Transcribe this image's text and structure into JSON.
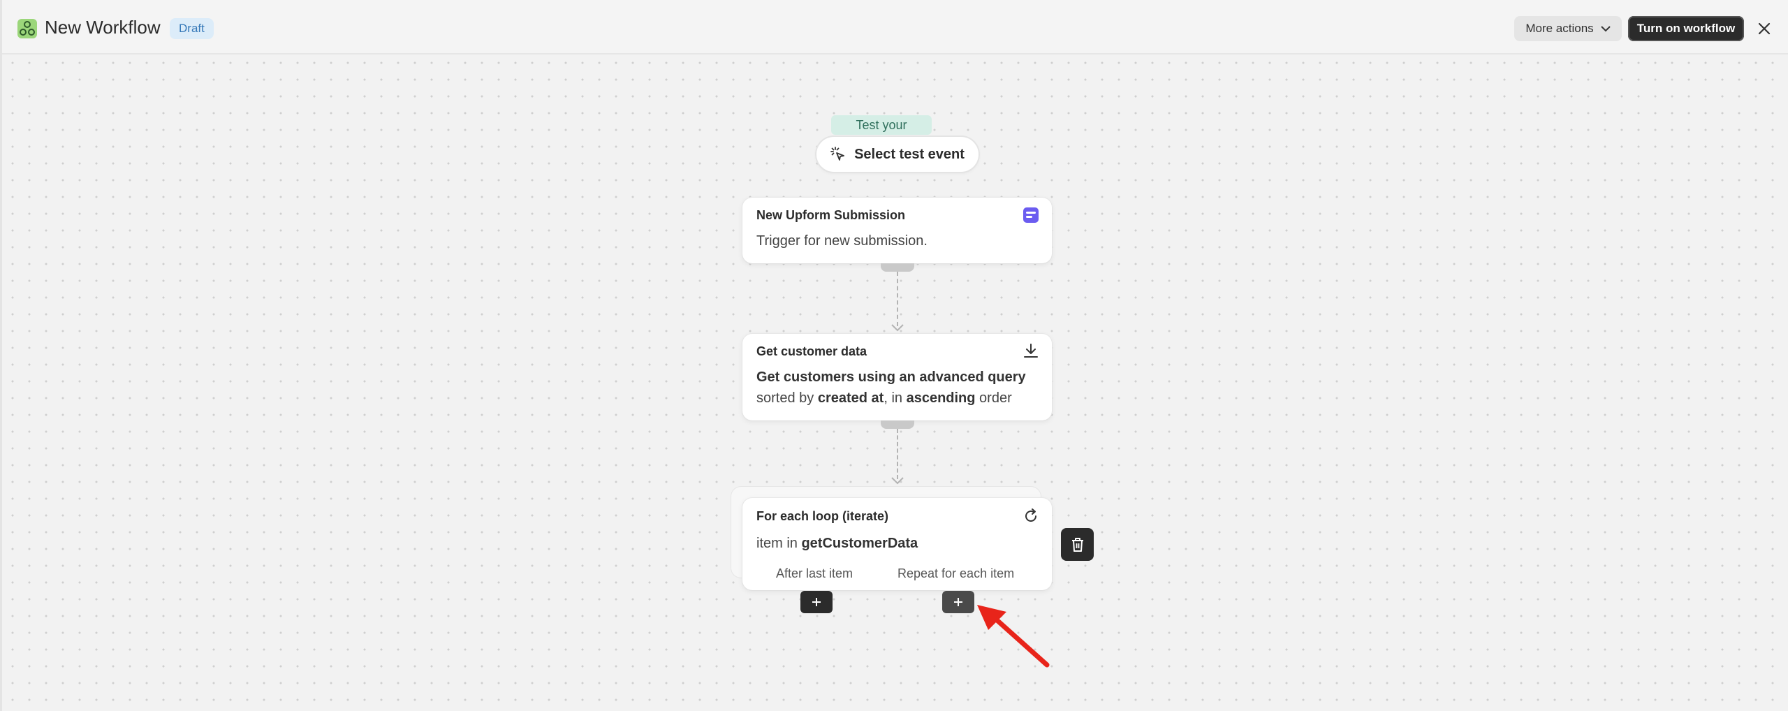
{
  "header": {
    "title": "New Workflow",
    "status_badge": "Draft",
    "more_actions_label": "More actions",
    "turn_on_label": "Turn on workflow"
  },
  "canvas": {
    "test_label": "Test your workflow",
    "select_test_event_label": "Select test event",
    "nodes": [
      {
        "title": "New Upform Submission",
        "description": "Trigger for new submission.",
        "icon": "upform-icon"
      },
      {
        "title": "Get customer data",
        "line1_bold": "Get customers using an advanced query",
        "line2_prefix": "sorted by ",
        "line2_bold1": "created at",
        "line2_mid": ", in ",
        "line2_bold2": "ascending",
        "line2_suffix": " order",
        "icon": "download-icon"
      },
      {
        "title": "For each loop (iterate)",
        "desc_prefix": "item in ",
        "desc_bold": "getCustomerData",
        "icon": "refresh-icon",
        "branches": [
          "After last item",
          "Repeat for each item"
        ]
      }
    ]
  },
  "colors": {
    "accent_dark": "#2b2b2b",
    "draft_badge_bg": "#dcecf9",
    "test_pill_bg": "#d5eee6",
    "annotation_arrow": "#e8241a"
  }
}
